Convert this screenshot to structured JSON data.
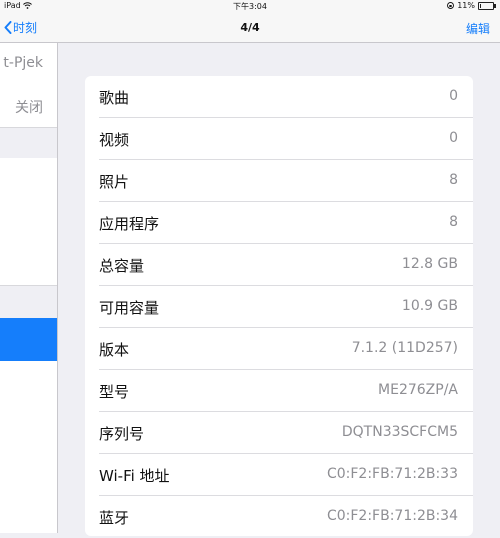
{
  "status_bar": {
    "device": "iPad",
    "wifi_icon": "wifi-icon",
    "time": "下午3:04",
    "battery_percent": "11%",
    "battery_level": 0.11
  },
  "nav_bar": {
    "back_label": "时刻",
    "title": "4/4",
    "edit_label": "编辑",
    "accent_color": "#157efb"
  },
  "left_pane": {
    "name_text": "t-Pjek",
    "off_text": "关闭"
  },
  "info": {
    "rows": [
      {
        "label": "歌曲",
        "value": "0"
      },
      {
        "label": "视频",
        "value": "0"
      },
      {
        "label": "照片",
        "value": "8"
      },
      {
        "label": "应用程序",
        "value": "8"
      },
      {
        "label": "总容量",
        "value": "12.8 GB"
      },
      {
        "label": "可用容量",
        "value": "10.9 GB"
      },
      {
        "label": "版本",
        "value": "7.1.2 (11D257)"
      },
      {
        "label": "型号",
        "value": "ME276ZP/A"
      },
      {
        "label": "序列号",
        "value": "DQTN33SCFCM5"
      },
      {
        "label": "Wi-Fi 地址",
        "value": "C0:F2:FB:71:2B:33"
      },
      {
        "label": "蓝牙",
        "value": "C0:F2:FB:71:2B:34"
      }
    ]
  }
}
